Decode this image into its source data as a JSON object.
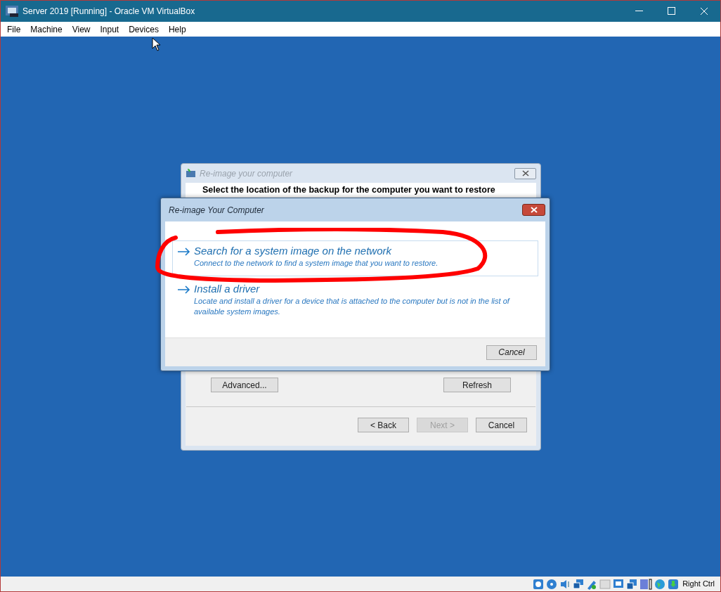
{
  "window": {
    "title": "Server 2019 [Running] - Oracle VM VirtualBox"
  },
  "menu": [
    "File",
    "Machine",
    "View",
    "Input",
    "Devices",
    "Help"
  ],
  "back_dialog": {
    "title": "Re-image your computer",
    "heading": "Select the location of the backup for the computer you want to restore",
    "buttons": [
      {
        "label": "Advanced..."
      },
      {
        "label": "Refresh"
      }
    ],
    "nav_buttons": [
      {
        "label": "< Back",
        "disabled": false
      },
      {
        "label": "Next >",
        "disabled": true
      },
      {
        "label": "Cancel",
        "disabled": false
      }
    ]
  },
  "front_dialog": {
    "title": "Re-image Your Computer",
    "options": [
      {
        "title": "Search for a system image on the network",
        "description": "Connect to the network to find a system image that you want to restore.",
        "selected": true
      },
      {
        "title": "Install a driver",
        "description": "Locate and install a driver for a device that is attached to the computer but is not in the list of available system images.",
        "selected": false
      }
    ],
    "cancel": "Cancel"
  },
  "status_bar": {
    "host_key": "Right Ctrl"
  }
}
